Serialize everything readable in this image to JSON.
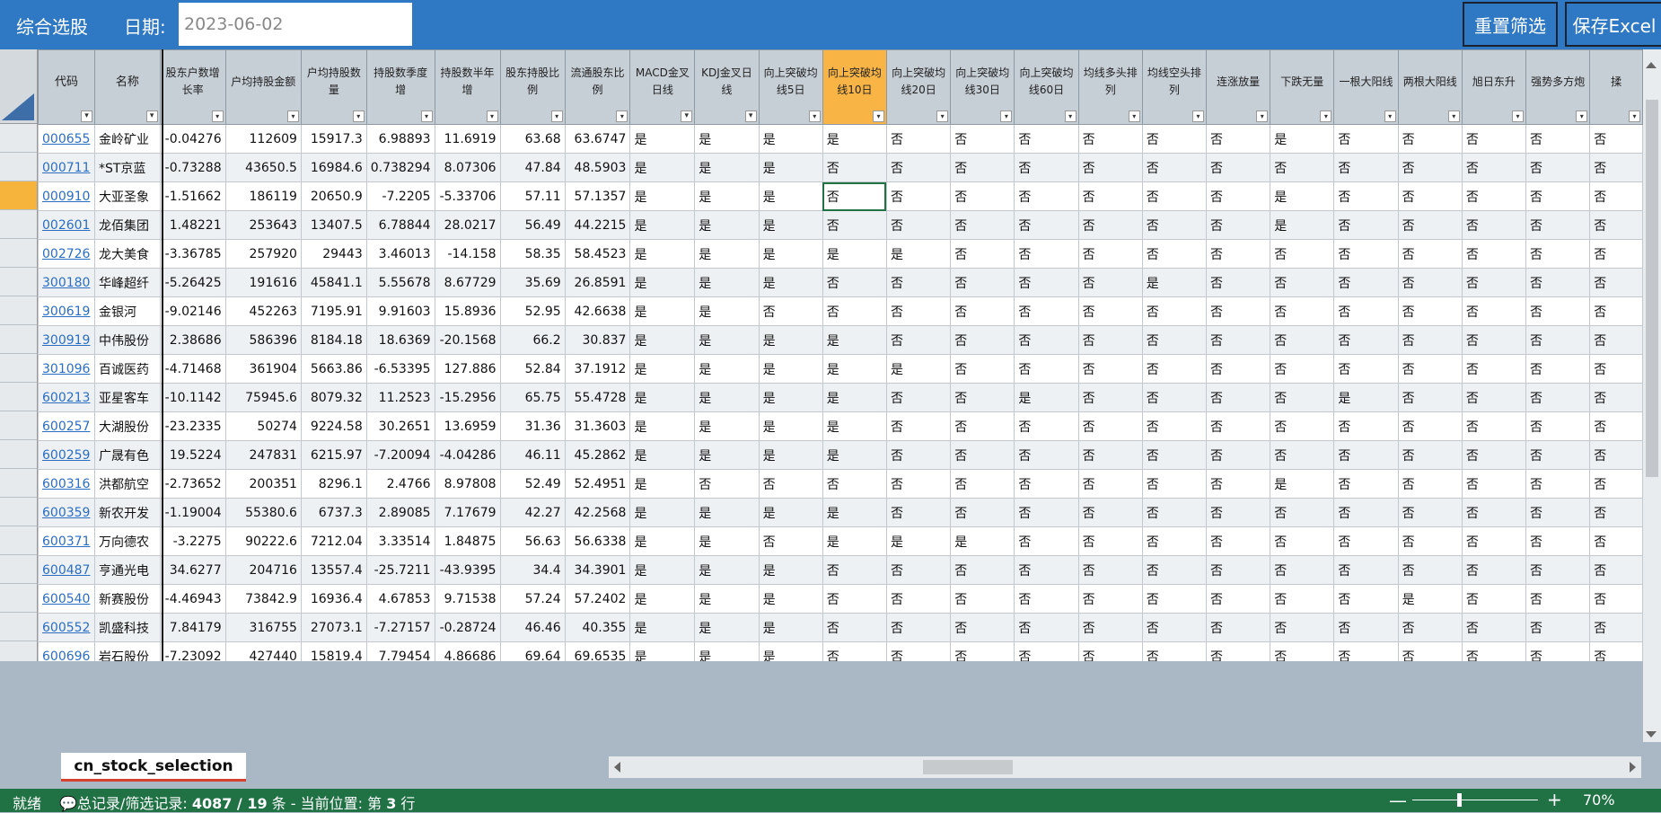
{
  "app": {
    "title": "综合选股",
    "date_label": "日期:",
    "date_value": "2023-06-02",
    "reset_button": "重置筛选",
    "save_button": "保存Excel"
  },
  "columns": [
    {
      "label": "代码",
      "filter": "on"
    },
    {
      "label": "名称",
      "filter": "on"
    },
    {
      "label": "股东户数增长率",
      "filter": "off"
    },
    {
      "label": "户均持股金额",
      "filter": "off"
    },
    {
      "label": "户均持股数量",
      "filter": "off"
    },
    {
      "label": "持股数季度增",
      "filter": "off"
    },
    {
      "label": "持股数半年增",
      "filter": "off"
    },
    {
      "label": "股东持股比例",
      "filter": "off"
    },
    {
      "label": "流通股东比例",
      "filter": "off"
    },
    {
      "label": "MACD金叉日线",
      "filter": "on"
    },
    {
      "label": "KDJ金叉日线",
      "filter": "on"
    },
    {
      "label": "向上突破均线5日",
      "filter": "off"
    },
    {
      "label": "向上突破均线10日",
      "filter": "off",
      "highlight": true
    },
    {
      "label": "向上突破均线20日",
      "filter": "off"
    },
    {
      "label": "向上突破均线30日",
      "filter": "off"
    },
    {
      "label": "向上突破均线60日",
      "filter": "off"
    },
    {
      "label": "均线多头排列",
      "filter": "off"
    },
    {
      "label": "均线空头排列",
      "filter": "off"
    },
    {
      "label": "连涨放量",
      "filter": "off"
    },
    {
      "label": "下跌无量",
      "filter": "off"
    },
    {
      "label": "一根大阳线",
      "filter": "off"
    },
    {
      "label": "两根大阳线",
      "filter": "off"
    },
    {
      "label": "旭日东升",
      "filter": "off"
    },
    {
      "label": "强势多方炮",
      "filter": "off"
    },
    {
      "label": "揉",
      "filter": "off"
    }
  ],
  "rows": [
    [
      "000655",
      "金岭矿业",
      "-0.04276",
      "112609",
      "15917.3",
      "6.98893",
      "11.6919",
      "63.68",
      "63.6747",
      "是",
      "是",
      "是",
      "是",
      "否",
      "否",
      "否",
      "否",
      "否",
      "否",
      "是",
      "否",
      "否",
      "否",
      "否",
      "否"
    ],
    [
      "000711",
      "*ST京蓝",
      "-0.73288",
      "43650.5",
      "16984.6",
      "0.738294",
      "8.07306",
      "47.84",
      "48.5903",
      "是",
      "是",
      "是",
      "否",
      "否",
      "否",
      "否",
      "否",
      "否",
      "否",
      "否",
      "否",
      "否",
      "否",
      "否",
      "否"
    ],
    [
      "000910",
      "大亚圣象",
      "-1.51662",
      "186119",
      "20650.9",
      "-7.2205",
      "-5.33706",
      "57.11",
      "57.1357",
      "是",
      "是",
      "是",
      "否",
      "否",
      "否",
      "否",
      "否",
      "否",
      "否",
      "是",
      "否",
      "否",
      "否",
      "否",
      "否"
    ],
    [
      "002601",
      "龙佰集团",
      "1.48221",
      "253643",
      "13407.5",
      "6.78844",
      "28.0217",
      "56.49",
      "44.2215",
      "是",
      "是",
      "是",
      "否",
      "否",
      "否",
      "否",
      "否",
      "否",
      "否",
      "是",
      "否",
      "否",
      "否",
      "否",
      "否"
    ],
    [
      "002726",
      "龙大美食",
      "-3.36785",
      "257920",
      "29443",
      "3.46013",
      "-14.158",
      "58.35",
      "58.4523",
      "是",
      "是",
      "是",
      "是",
      "是",
      "否",
      "否",
      "否",
      "否",
      "否",
      "否",
      "否",
      "否",
      "否",
      "否",
      "否"
    ],
    [
      "300180",
      "华峰超纤",
      "-5.26425",
      "191616",
      "45841.1",
      "5.55678",
      "8.67729",
      "35.69",
      "26.8591",
      "是",
      "是",
      "是",
      "否",
      "否",
      "否",
      "否",
      "否",
      "是",
      "否",
      "否",
      "否",
      "否",
      "否",
      "否",
      "否"
    ],
    [
      "300619",
      "金银河",
      "-9.02146",
      "452263",
      "7195.91",
      "9.91603",
      "15.8936",
      "52.95",
      "42.6638",
      "是",
      "是",
      "否",
      "否",
      "否",
      "否",
      "否",
      "否",
      "否",
      "否",
      "否",
      "否",
      "否",
      "否",
      "否",
      "否"
    ],
    [
      "300919",
      "中伟股份",
      "2.38686",
      "586396",
      "8184.18",
      "18.6369",
      "-20.1568",
      "66.2",
      "30.837",
      "是",
      "是",
      "是",
      "是",
      "否",
      "否",
      "否",
      "否",
      "否",
      "否",
      "否",
      "否",
      "否",
      "否",
      "否",
      "否"
    ],
    [
      "301096",
      "百诚医药",
      "-4.71468",
      "361904",
      "5663.86",
      "-6.53395",
      "127.886",
      "52.84",
      "37.1912",
      "是",
      "是",
      "是",
      "是",
      "是",
      "否",
      "否",
      "否",
      "否",
      "否",
      "否",
      "否",
      "否",
      "否",
      "否",
      "否"
    ],
    [
      "600213",
      "亚星客车",
      "-10.1142",
      "75945.6",
      "8079.32",
      "11.2523",
      "-15.2956",
      "65.75",
      "55.4728",
      "是",
      "是",
      "是",
      "是",
      "否",
      "否",
      "是",
      "否",
      "否",
      "否",
      "否",
      "是",
      "否",
      "否",
      "否",
      "否"
    ],
    [
      "600257",
      "大湖股份",
      "-23.2335",
      "50274",
      "9224.58",
      "30.2651",
      "13.6959",
      "31.36",
      "31.3603",
      "是",
      "是",
      "是",
      "是",
      "否",
      "否",
      "否",
      "否",
      "否",
      "否",
      "否",
      "否",
      "否",
      "否",
      "否",
      "否"
    ],
    [
      "600259",
      "广晟有色",
      "19.5224",
      "247831",
      "6215.97",
      "-7.20094",
      "-4.04286",
      "46.11",
      "45.2862",
      "是",
      "是",
      "是",
      "是",
      "否",
      "否",
      "否",
      "否",
      "否",
      "否",
      "否",
      "否",
      "否",
      "否",
      "否",
      "否"
    ],
    [
      "600316",
      "洪都航空",
      "-2.73652",
      "200351",
      "8296.1",
      "2.4766",
      "8.97808",
      "52.49",
      "52.4951",
      "是",
      "否",
      "否",
      "否",
      "否",
      "否",
      "否",
      "否",
      "否",
      "否",
      "是",
      "否",
      "否",
      "否",
      "否",
      "否"
    ],
    [
      "600359",
      "新农开发",
      "-1.19004",
      "55380.6",
      "6737.3",
      "2.89085",
      "7.17679",
      "42.27",
      "42.2568",
      "是",
      "是",
      "是",
      "是",
      "否",
      "否",
      "否",
      "否",
      "否",
      "否",
      "否",
      "否",
      "否",
      "否",
      "否",
      "否"
    ],
    [
      "600371",
      "万向德农",
      "-3.2275",
      "90222.6",
      "7212.04",
      "3.33514",
      "1.84875",
      "56.63",
      "56.6338",
      "是",
      "是",
      "否",
      "是",
      "是",
      "是",
      "否",
      "否",
      "否",
      "否",
      "否",
      "否",
      "否",
      "否",
      "否",
      "否"
    ],
    [
      "600487",
      "亨通光电",
      "34.6277",
      "204716",
      "13557.4",
      "-25.7211",
      "-43.9395",
      "34.4",
      "34.3901",
      "是",
      "是",
      "是",
      "否",
      "否",
      "否",
      "否",
      "否",
      "否",
      "否",
      "否",
      "否",
      "否",
      "否",
      "否",
      "否"
    ],
    [
      "600540",
      "新赛股份",
      "-4.46943",
      "73842.9",
      "16936.4",
      "4.67853",
      "9.71538",
      "57.24",
      "57.2402",
      "是",
      "是",
      "是",
      "否",
      "否",
      "否",
      "否",
      "否",
      "否",
      "否",
      "否",
      "否",
      "是",
      "否",
      "否",
      "否"
    ],
    [
      "600552",
      "凯盛科技",
      "7.84179",
      "316755",
      "27073.1",
      "-7.27157",
      "-0.28724",
      "46.46",
      "40.355",
      "是",
      "是",
      "是",
      "否",
      "否",
      "否",
      "否",
      "否",
      "否",
      "否",
      "否",
      "否",
      "否",
      "否",
      "否",
      "否"
    ],
    [
      "600696",
      "岩石股份",
      "-7.23092",
      "427440",
      "15819.4",
      "7.79454",
      "4.86686",
      "69.64",
      "69.6535",
      "是",
      "是",
      "是",
      "否",
      "否",
      "否",
      "否",
      "否",
      "否",
      "否",
      "否",
      "否",
      "否",
      "否",
      "否",
      "否"
    ]
  ],
  "sheet_tab": "cn_stock_selection",
  "status": {
    "ready": "就绪",
    "prefix": "总记录/筛选记录:",
    "total": "4087",
    "sep": " / ",
    "filtered": "19",
    "mid": " 条 - 当前位置: 第 ",
    "position": "3",
    "suffix": " 行"
  },
  "zoom": {
    "minus": "—",
    "plus": "+",
    "percent": "70%",
    "level": 0.7
  },
  "colors": {
    "accent": "#2f78c4",
    "status_bar": "#207245",
    "highlight_header": "#f8b545",
    "link": "#2b6ec4"
  }
}
